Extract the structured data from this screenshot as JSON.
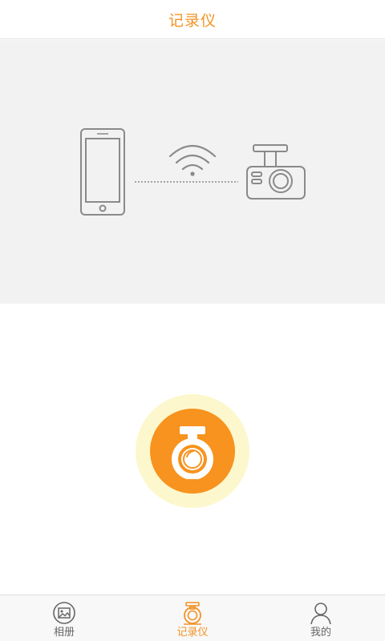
{
  "header": {
    "title": "记录仪"
  },
  "hero": {
    "phone_icon": "smartphone-icon",
    "wifi_icon": "wifi-icon",
    "dashcam_icon": "dashcam-icon",
    "line_color": "#8a8a8a"
  },
  "record_button": {
    "icon": "dashcam-icon",
    "outer_color": "#fdf7cd",
    "inner_color": "#f7931e"
  },
  "tabbar": {
    "tabs": [
      {
        "label": "相册",
        "icon": "album-icon",
        "active": false
      },
      {
        "label": "记录仪",
        "icon": "dashcam-icon",
        "active": true
      },
      {
        "label": "我的",
        "icon": "person-icon",
        "active": false
      }
    ],
    "active_color": "#f39325",
    "inactive_color": "#666666"
  }
}
